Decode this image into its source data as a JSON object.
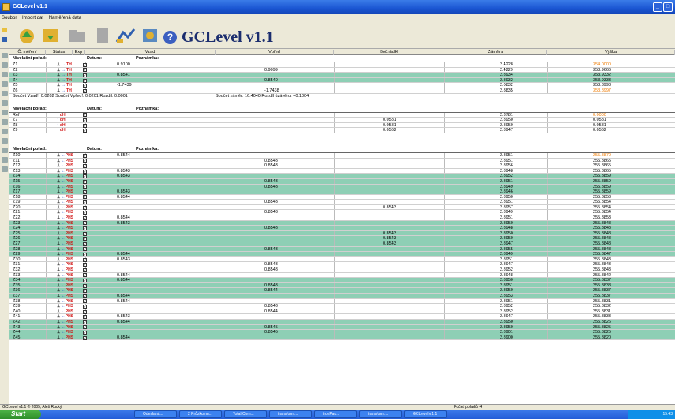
{
  "window": {
    "title": "GCLevel v1.1",
    "app_heading": "GCLevel v1.1"
  },
  "menu": [
    "Soubor",
    "Import dat",
    "Naměřená data"
  ],
  "columns": [
    "Č. měření",
    "Status",
    "Exp",
    "Vzad",
    "Vpřed",
    "Boční/dH",
    "Záměra",
    "Výška"
  ],
  "section_header": {
    "name": "Nivelační pořad:",
    "datum": "Datum:",
    "note": "Poznámka:"
  },
  "rows": [
    {
      "t": "sec"
    },
    {
      "id": "Z1",
      "st": "s",
      "v": "0.9100",
      "vp": "",
      "b": "",
      "z": "2.4228",
      "h": "354.0000",
      "ho": true
    },
    {
      "id": "Z2",
      "st": "s",
      "v": "",
      "vp": "0.9099",
      "b": "",
      "z": "2.4229",
      "h": "353.9666"
    },
    {
      "id": "Z3",
      "st": "g",
      "g": true,
      "v": "0.8541",
      "vp": "",
      "b": "",
      "z": "2.8934",
      "h": "353.9332"
    },
    {
      "id": "Z4",
      "st": "s",
      "g": true,
      "v": "",
      "vp": "0.8540",
      "b": "",
      "z": "2.8932",
      "h": "353.9333"
    },
    {
      "id": "Z5",
      "st": "s",
      "v": "-1.7439",
      "vp": "",
      "b": "",
      "z": "2.0832",
      "h": "353.8998"
    },
    {
      "id": "Z6",
      "st": "s",
      "v": "",
      "vp": "-1.7438",
      "b": "",
      "z": "2.8835",
      "h": "353.8997",
      "ho": true
    },
    {
      "t": "sum",
      "text": "Součet Vzad!: 0.0202      Součet Vpřed!: 0.0201      Rozdíl: 0.0001",
      "text2": "Součet záměr: 16.4040      Rozdíl úzávěru: +0.1004"
    },
    {
      "t": "blank"
    },
    {
      "t": "sec"
    },
    {
      "id": "Ref",
      "st": "b",
      "v": "",
      "vp": "",
      "b": "",
      "z": "2.3781",
      "h": "0.0000",
      "ho": true
    },
    {
      "id": "Z7",
      "st": "b",
      "v": "",
      "vp": "",
      "b": "0.0581",
      "z": "2.8950",
      "h": "0.0581"
    },
    {
      "id": "Z8",
      "st": "b",
      "v": "",
      "vp": "",
      "b": "0.0581",
      "z": "2.8950",
      "h": "0.0581"
    },
    {
      "id": "Z9",
      "st": "b",
      "v": "",
      "vp": "",
      "b": "0.0562",
      "z": "2.8947",
      "h": "0.0562"
    },
    {
      "t": "blank"
    },
    {
      "t": "blank"
    },
    {
      "t": "sec"
    },
    {
      "id": "Z10",
      "st": "p",
      "v": "0.8544",
      "vp": "",
      "b": "",
      "z": "2.8951",
      "h": "255.8870",
      "ho": true
    },
    {
      "id": "Z11",
      "st": "p",
      "v": "",
      "vp": "0.8543",
      "b": "",
      "z": "2.8951",
      "h": "255.8865"
    },
    {
      "id": "Z12",
      "st": "p",
      "v": "",
      "vp": "0.8543",
      "b": "",
      "z": "2.8956",
      "h": "255.8865"
    },
    {
      "id": "Z13",
      "st": "p",
      "v": "0.8543",
      "vp": "",
      "b": "",
      "z": "2.8948",
      "h": "255.8865"
    },
    {
      "id": "Z14",
      "st": "p",
      "g": true,
      "v": "0.8543",
      "vp": "",
      "b": "",
      "z": "2.8952",
      "h": "255.8859"
    },
    {
      "id": "Z15",
      "st": "p",
      "g": true,
      "v": "",
      "vp": "0.8543",
      "b": "",
      "z": "2.8951",
      "h": "255.8859"
    },
    {
      "id": "Z16",
      "st": "p",
      "g": true,
      "v": "",
      "vp": "0.8543",
      "b": "",
      "z": "2.8949",
      "h": "255.8859"
    },
    {
      "id": "Z17",
      "st": "p",
      "g": true,
      "v": "0.8543",
      "vp": "",
      "b": "",
      "z": "2.8946",
      "h": "255.8859"
    },
    {
      "id": "Z18",
      "st": "p",
      "v": "0.8544",
      "vp": "",
      "b": "",
      "z": "2.8950",
      "h": "255.8853"
    },
    {
      "id": "Z19",
      "st": "p",
      "v": "",
      "vp": "0.8543",
      "b": "",
      "z": "2.8951",
      "h": "255.8854"
    },
    {
      "id": "Z20",
      "st": "p",
      "v": "",
      "vp": "",
      "b": "0.8543",
      "z": "2.8957",
      "h": "255.8854"
    },
    {
      "id": "Z21",
      "st": "p",
      "v": "",
      "vp": "0.8543",
      "b": "",
      "z": "2.8949",
      "h": "255.8854"
    },
    {
      "id": "Z22",
      "st": "p",
      "v": "0.8544",
      "vp": "",
      "b": "",
      "z": "2.8951",
      "h": "255.8853"
    },
    {
      "id": "Z23",
      "st": "p",
      "g": true,
      "v": "0.8543",
      "vp": "",
      "b": "",
      "z": "2.8950",
      "h": "255.8848"
    },
    {
      "id": "Z24",
      "st": "p",
      "g": true,
      "v": "",
      "vp": "0.8543",
      "b": "",
      "z": "2.8948",
      "h": "255.8848"
    },
    {
      "id": "Z25",
      "st": "p",
      "g": true,
      "v": "",
      "vp": "",
      "b": "0.8543",
      "z": "2.8950",
      "h": "255.8848"
    },
    {
      "id": "Z26",
      "st": "p",
      "g": true,
      "v": "",
      "vp": "",
      "b": "0.8543",
      "z": "2.8950",
      "h": "255.8848"
    },
    {
      "id": "Z27",
      "st": "p",
      "g": true,
      "v": "",
      "vp": "",
      "b": "0.8543",
      "z": "2.8947",
      "h": "255.8848"
    },
    {
      "id": "Z28",
      "st": "p",
      "g": true,
      "v": "",
      "vp": "0.8543",
      "b": "",
      "z": "2.8955",
      "h": "255.8848"
    },
    {
      "id": "Z29",
      "st": "p",
      "g": true,
      "v": "0.8544",
      "vp": "",
      "b": "",
      "z": "2.8949",
      "h": "255.8847"
    },
    {
      "id": "Z30",
      "st": "p",
      "v": "0.8543",
      "vp": "",
      "b": "",
      "z": "2.8951",
      "h": "255.8843"
    },
    {
      "id": "Z31",
      "st": "p",
      "v": "",
      "vp": "0.8543",
      "b": "",
      "z": "2.8947",
      "h": "255.8843"
    },
    {
      "id": "Z32",
      "st": "p",
      "v": "",
      "vp": "0.8543",
      "b": "",
      "z": "2.8952",
      "h": "255.8843"
    },
    {
      "id": "Z33",
      "st": "p",
      "v": "0.8544",
      "vp": "",
      "b": "",
      "z": "2.8948",
      "h": "255.8842"
    },
    {
      "id": "Z34",
      "st": "p",
      "g": true,
      "v": "0.8544",
      "vp": "",
      "b": "",
      "z": "2.8950",
      "h": "255.8837"
    },
    {
      "id": "Z35",
      "st": "p",
      "g": true,
      "v": "",
      "vp": "0.8543",
      "b": "",
      "z": "2.8951",
      "h": "255.8838"
    },
    {
      "id": "Z36",
      "st": "p",
      "g": true,
      "v": "",
      "vp": "0.8544",
      "b": "",
      "z": "2.8950",
      "h": "255.8837"
    },
    {
      "id": "Z37",
      "st": "p",
      "g": true,
      "v": "0.8544",
      "vp": "",
      "b": "",
      "z": "2.8953",
      "h": "255.8837"
    },
    {
      "id": "Z38",
      "st": "p",
      "v": "0.8544",
      "vp": "",
      "b": "",
      "z": "2.8951",
      "h": "255.8831"
    },
    {
      "id": "Z39",
      "st": "p",
      "v": "",
      "vp": "0.8543",
      "b": "",
      "z": "2.8952",
      "h": "255.8832"
    },
    {
      "id": "Z40",
      "st": "p",
      "v": "",
      "vp": "0.8544",
      "b": "",
      "z": "2.8952",
      "h": "255.8831"
    },
    {
      "id": "Z41",
      "st": "p",
      "v": "0.8543",
      "vp": "",
      "b": "",
      "z": "2.8947",
      "h": "255.8833"
    },
    {
      "id": "Z42",
      "st": "p",
      "g": true,
      "v": "0.8544",
      "vp": "",
      "b": "",
      "z": "2.8950",
      "h": "255.8826"
    },
    {
      "id": "Z43",
      "st": "p",
      "g": true,
      "v": "",
      "vp": "0.8545",
      "b": "",
      "z": "2.8950",
      "h": "255.8825"
    },
    {
      "id": "Z44",
      "st": "p",
      "g": true,
      "v": "",
      "vp": "0.8545",
      "b": "",
      "z": "2.8901",
      "h": "255.8825"
    },
    {
      "id": "Z45",
      "st": "p",
      "g": true,
      "v": "0.8544",
      "vp": "",
      "b": "",
      "z": "2.8900",
      "h": "255.8820"
    }
  ],
  "statusbar": {
    "left": "GCLevel v1.1   © 2005, Aleš Rucký",
    "right": "Počet pořadů: 4"
  },
  "taskbar": {
    "start": "Start",
    "tasks": [
      "Odeslaná...",
      "2 Průzkumn...",
      "Total Com...",
      "transform...",
      "trozPad...",
      "transform...",
      "GCLevel v1.1"
    ],
    "clock": "15:43"
  },
  "colors": {
    "green_row": "#8ecfb5",
    "orange": "#ee7a00",
    "title_blue": "#1b2d6e"
  }
}
